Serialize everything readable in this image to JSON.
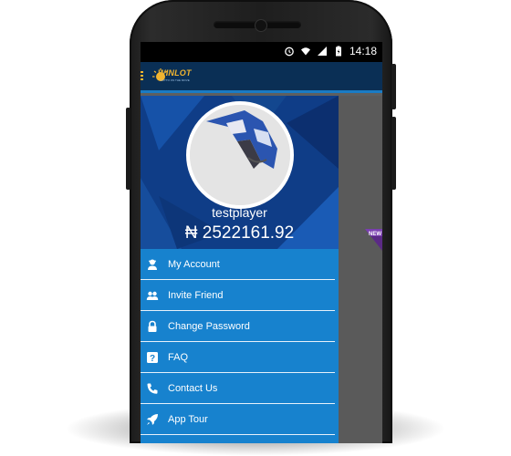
{
  "status_bar": {
    "time": "14:18"
  },
  "app_bar": {
    "logo_text": "WINLOT",
    "logo_subtitle": "LOTTO ON THE MOVE"
  },
  "profile": {
    "username": "testplayer",
    "balance": "₦ 2522161.92"
  },
  "menu": {
    "items": [
      {
        "label": "My Account",
        "icon": "user-icon"
      },
      {
        "label": "Invite Friend",
        "icon": "people-icon"
      },
      {
        "label": "Change Password",
        "icon": "lock-icon"
      },
      {
        "label": "FAQ",
        "icon": "question-icon"
      },
      {
        "label": "Contact Us",
        "icon": "phone-icon"
      },
      {
        "label": "App Tour",
        "icon": "rocket-icon"
      }
    ]
  },
  "background_badge": {
    "text": "NEW"
  },
  "colors": {
    "drawer": "#1782ce",
    "app_bar": "#0a2f55",
    "header": "#0f3d87",
    "accent": "#f2b530"
  }
}
